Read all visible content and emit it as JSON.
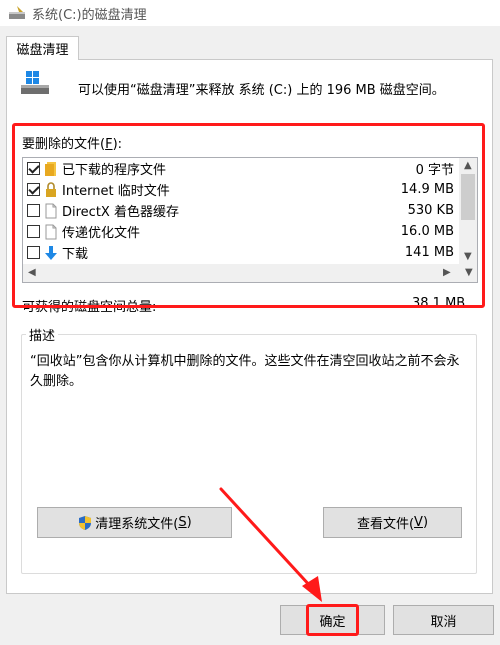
{
  "window": {
    "title": "系统(C:)的磁盘清理"
  },
  "tab": {
    "label": "磁盘清理"
  },
  "intro": {
    "text": "可以使用“磁盘清理”来释放 系统 (C:) 上的 196 MB 磁盘空间。"
  },
  "files": {
    "label_pre": "要删除的文件(",
    "label_key": "F",
    "label_post": "):",
    "rows": [
      {
        "name": "已下载的程序文件",
        "size": "0 字节",
        "checked": true,
        "icon": "folder-icon"
      },
      {
        "name": "Internet 临时文件",
        "size": "14.9 MB",
        "checked": true,
        "icon": "lock-icon"
      },
      {
        "name": "DirectX 着色器缓存",
        "size": "530 KB",
        "checked": false,
        "icon": "file-icon"
      },
      {
        "name": "传递优化文件",
        "size": "16.0 MB",
        "checked": false,
        "icon": "file-icon"
      },
      {
        "name": "下载",
        "size": "141 MB",
        "checked": false,
        "icon": "download-icon"
      }
    ]
  },
  "total": {
    "label": "可获得的磁盘空间总量:",
    "value": "38.1 MB"
  },
  "description": {
    "title": "描述",
    "text": "“回收站”包含你从计算机中删除的文件。这些文件在清空回收站之前不会永久删除。"
  },
  "buttons": {
    "cleanup_system_pre": "清理系统文件(",
    "cleanup_system_key": "S",
    "cleanup_system_post": ")",
    "view_files_pre": "查看文件(",
    "view_files_key": "V",
    "view_files_post": ")",
    "ok": "确定",
    "cancel": "取消"
  },
  "colors": {
    "annotation": "#ff1a1a",
    "background": "#f0f0f0"
  }
}
